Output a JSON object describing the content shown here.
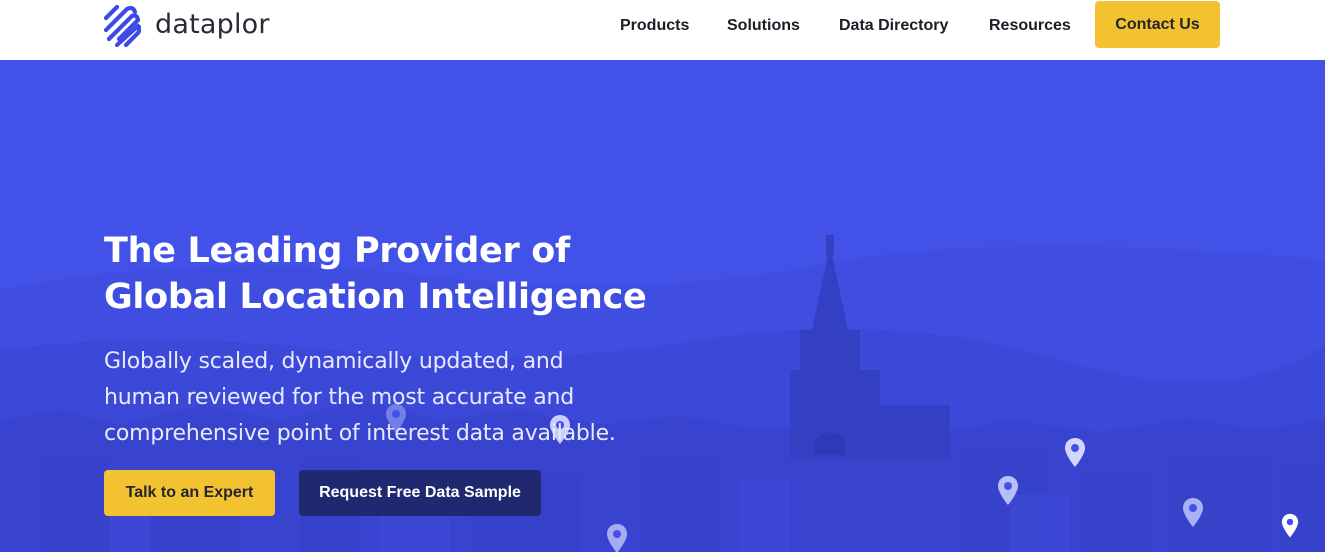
{
  "brand": {
    "name": "dataplor",
    "logo_icon": "fingerprint-stripes-icon",
    "logo_color": "#3d4be6"
  },
  "nav": {
    "items": [
      {
        "label": "Products"
      },
      {
        "label": "Solutions"
      },
      {
        "label": "Data Directory"
      },
      {
        "label": "Resources"
      }
    ],
    "cta_label": "Contact Us"
  },
  "hero": {
    "headline_line1": "The Leading Provider of",
    "headline_line2": "Global Location Intelligence",
    "subhead_line1": "Globally scaled, dynamically updated, and",
    "subhead_line2": "human reviewed for the most accurate and",
    "subhead_line3": "comprehensive point of interest data available.",
    "primary_button": "Talk to an Expert",
    "secondary_button": "Request Free Data Sample",
    "background_image": "city-skyline-with-cathedral",
    "map_pin_icon": "map-pin-icon"
  },
  "colors": {
    "hero_blue": "#4250ea",
    "accent_yellow": "#f2c230",
    "dark_navy": "#202870",
    "header_bg": "#ffffff"
  }
}
